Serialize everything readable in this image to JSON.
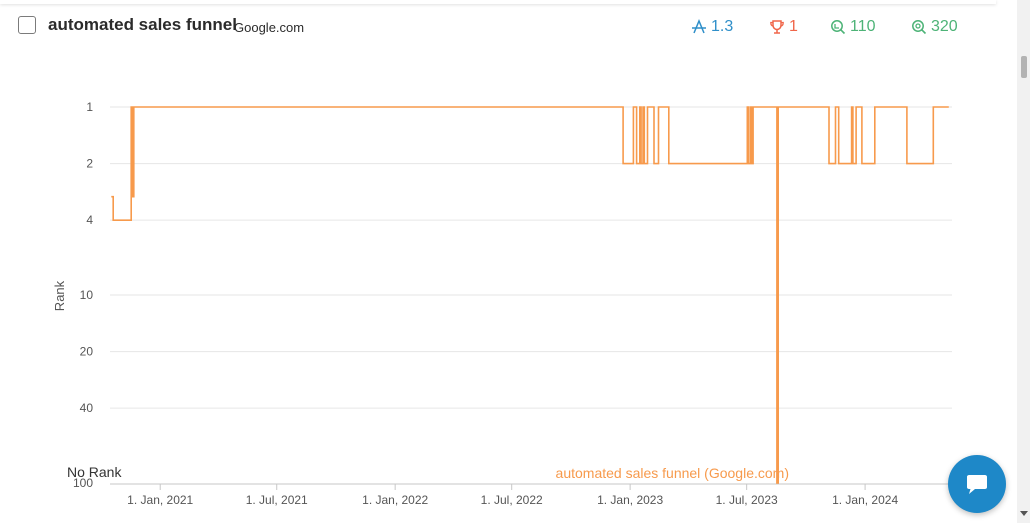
{
  "header": {
    "keyword": "automated sales funnel",
    "engine": "Google.com",
    "metrics": [
      {
        "icon": "average-rank-icon",
        "value": "1.3",
        "color": "#2f8fc9"
      },
      {
        "icon": "trophy-icon",
        "value": "1",
        "color": "#f0664a"
      },
      {
        "icon": "search-volume-icon",
        "value": "110",
        "color": "#4db377"
      },
      {
        "icon": "results-icon",
        "value": "320",
        "color": "#4db377"
      }
    ]
  },
  "chart_data": {
    "type": "line",
    "ylabel": "Rank",
    "y_scale": "log",
    "y_reversed": true,
    "y_ticks": [
      {
        "value": 1,
        "label": "1"
      },
      {
        "value": 2,
        "label": "2"
      },
      {
        "value": 4,
        "label": "4"
      },
      {
        "value": 10,
        "label": "10"
      },
      {
        "value": 20,
        "label": "20"
      },
      {
        "value": 40,
        "label": "40"
      },
      {
        "value": 100,
        "label": "100"
      }
    ],
    "no_rank_label": "No Rank",
    "x_ticks": [
      "1. Jan, 2021",
      "1. Jul, 2021",
      "1. Jan, 2022",
      "1. Jul, 2022",
      "1. Jan, 2023",
      "1. Jul, 2023",
      "1. Jan, 2024"
    ],
    "xlim": [
      "2020-10-15",
      "2024-05-15"
    ],
    "grid": true,
    "line_color": "#f79a4c",
    "series": [
      {
        "name": "automated sales funnel (Google.com)",
        "points": [
          [
            "2020-10-17",
            3
          ],
          [
            "2020-10-20",
            4
          ],
          [
            "2020-11-15",
            4
          ],
          [
            "2020-11-17",
            1
          ],
          [
            "2020-11-19",
            3
          ],
          [
            "2020-11-21",
            1
          ],
          [
            "2022-12-20",
            1
          ],
          [
            "2022-12-21",
            2
          ],
          [
            "2023-01-05",
            2
          ],
          [
            "2023-01-06",
            1
          ],
          [
            "2023-01-10",
            1
          ],
          [
            "2023-01-11",
            2
          ],
          [
            "2023-01-15",
            2
          ],
          [
            "2023-01-16",
            1
          ],
          [
            "2023-01-18",
            2
          ],
          [
            "2023-01-21",
            1
          ],
          [
            "2023-01-23",
            2
          ],
          [
            "2023-01-27",
            2
          ],
          [
            "2023-01-28",
            1
          ],
          [
            "2023-02-06",
            1
          ],
          [
            "2023-02-07",
            2
          ],
          [
            "2023-02-13",
            2
          ],
          [
            "2023-02-14",
            1
          ],
          [
            "2023-03-01",
            1
          ],
          [
            "2023-03-02",
            2
          ],
          [
            "2023-07-01",
            2
          ],
          [
            "2023-07-02",
            1
          ],
          [
            "2023-07-04",
            2
          ],
          [
            "2023-07-07",
            1
          ],
          [
            "2023-07-09",
            2
          ],
          [
            "2023-07-11",
            1
          ],
          [
            "2023-08-15",
            1
          ],
          [
            "2023-08-17",
            100
          ],
          [
            "2023-08-19",
            1
          ],
          [
            "2023-11-05",
            1
          ],
          [
            "2023-11-06",
            2
          ],
          [
            "2023-11-15",
            2
          ],
          [
            "2023-11-16",
            1
          ],
          [
            "2023-11-20",
            1
          ],
          [
            "2023-11-21",
            2
          ],
          [
            "2023-12-10",
            2
          ],
          [
            "2023-12-11",
            1
          ],
          [
            "2023-12-13",
            2
          ],
          [
            "2023-12-17",
            2
          ],
          [
            "2023-12-18",
            1
          ],
          [
            "2023-12-26",
            1
          ],
          [
            "2023-12-27",
            2
          ],
          [
            "2024-01-15",
            2
          ],
          [
            "2024-01-16",
            1
          ],
          [
            "2024-03-05",
            1
          ],
          [
            "2024-03-06",
            2
          ],
          [
            "2024-04-15",
            2
          ],
          [
            "2024-04-16",
            1
          ],
          [
            "2024-05-10",
            1
          ]
        ]
      }
    ]
  }
}
